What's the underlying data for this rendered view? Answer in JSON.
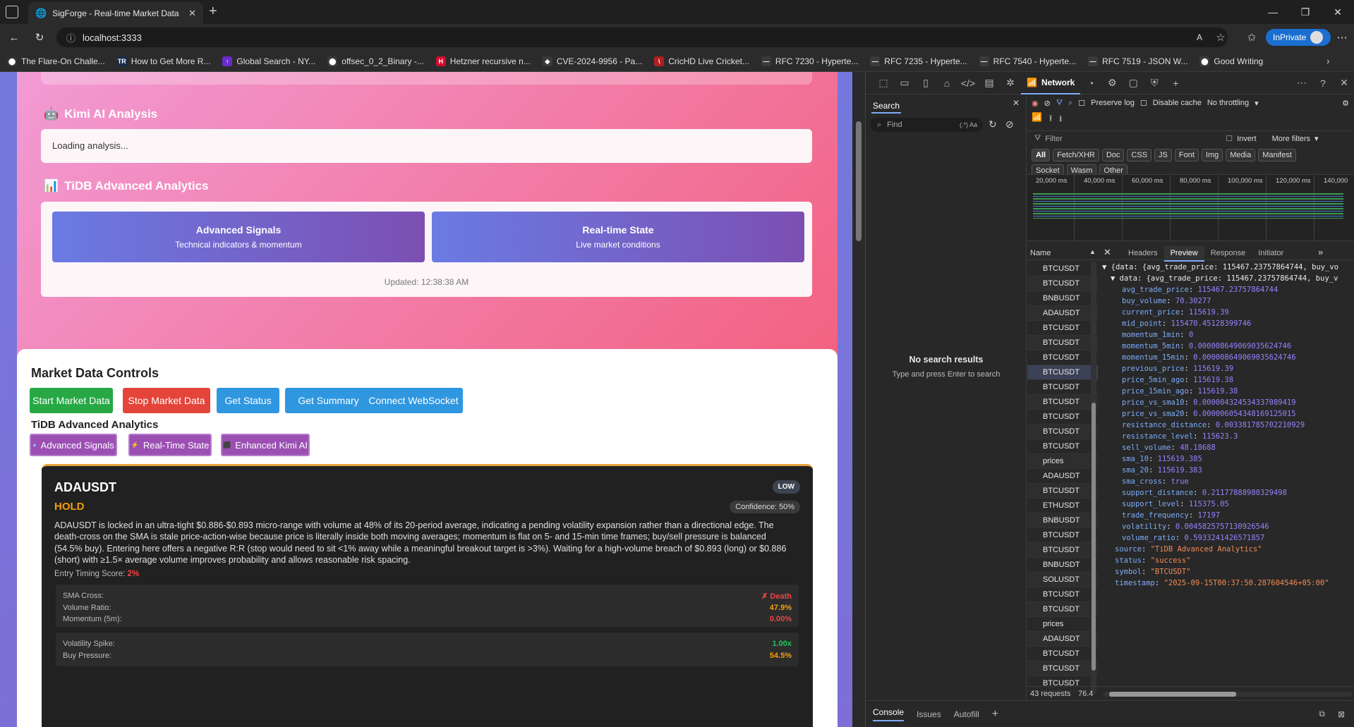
{
  "browser": {
    "tab_title": "SigForge - Real-time Market Data",
    "url": "localhost:3333",
    "inprivate_label": "InPrivate",
    "bookmarks": [
      {
        "label": "The Flare-On Challe...",
        "color": "#333",
        "glyph": "⬤"
      },
      {
        "label": "How to Get More R...",
        "color": "#1b2b4a",
        "glyph": "TR"
      },
      {
        "label": "Global Search - NY...",
        "color": "#6a2cc9",
        "glyph": "↑"
      },
      {
        "label": "offsec_0_2_Binary -...",
        "color": "#3a3a3a",
        "glyph": "⬤"
      },
      {
        "label": "Hetzner recursive n...",
        "color": "#d50c2d",
        "glyph": "H"
      },
      {
        "label": "CVE-2024-9956 - Pa...",
        "color": "#3a3a3a",
        "glyph": "◆"
      },
      {
        "label": "CricHD Live Cricket...",
        "color": "#b12020",
        "glyph": "\\"
      },
      {
        "label": "RFC 7230 - Hyperte...",
        "color": "#3a3a3a",
        "glyph": "—"
      },
      {
        "label": "RFC 7235 - Hyperte...",
        "color": "#3a3a3a",
        "glyph": "—"
      },
      {
        "label": "RFC 7540 - Hyperte...",
        "color": "#3a3a3a",
        "glyph": "—"
      },
      {
        "label": "RFC 7519 - JSON W...",
        "color": "#3a3a3a",
        "glyph": "—"
      },
      {
        "label": "Good Writing",
        "color": "#3a3a3a",
        "glyph": "⬤"
      }
    ]
  },
  "page": {
    "kimi": {
      "title": "Kimi AI Analysis",
      "loading": "Loading analysis..."
    },
    "tidb": {
      "title": "TiDB Advanced Analytics",
      "cards": [
        {
          "title": "Advanced Signals",
          "subtitle": "Technical indicators & momentum"
        },
        {
          "title": "Real-time State",
          "subtitle": "Live market conditions"
        }
      ],
      "updated": "Updated: 12:38:38 AM"
    },
    "controls": {
      "title": "Market Data Controls",
      "buttons": [
        {
          "label": "Start Market Data",
          "color": "#27a845"
        },
        {
          "label": "Stop Market Data",
          "color": "#e5443a"
        },
        {
          "label": "Get Status",
          "color": "#2f97e0"
        },
        {
          "label": "Get Summary",
          "color": "#2f97e0"
        },
        {
          "label": "Connect WebSocket",
          "color": "#2f97e0"
        }
      ],
      "tidb_label": "TiDB Advanced Analytics",
      "purple_buttons": [
        {
          "label": "Advanced Signals",
          "glyph": "●"
        },
        {
          "label": "Real-Time State",
          "glyph": "⚡"
        },
        {
          "label": "Enhanced Kimi AI",
          "glyph": "⬛"
        }
      ]
    },
    "signal_card": {
      "symbol": "ADAUSDT",
      "risk": "LOW",
      "action": "HOLD",
      "confidence": "Confidence: 50%",
      "description": "ADAUSDT is locked in an ultra-tight $0.886-$0.893 micro-range with volume at 48% of its 20-period average, indicating a pending volatility expansion rather than a directional edge. The death-cross on the SMA is stale price-action-wise because price is literally inside both moving averages; momentum is flat on 5- and 15-min time frames; buy/sell pressure is balanced (54.5% buy). Entering here offers a negative R:R (stop would need to sit <1% away while a meaningful breakout target is >3%). Waiting for a high-volume breach of $0.893 (long) or $0.886 (short) with ≥1.5× average volume improves probability and allows reasonable risk spacing.",
      "entry_label": "Entry Timing Score:",
      "entry_value": "2%",
      "metrics1": [
        {
          "label": "SMA Cross:",
          "value": "✗ Death",
          "color": "#ef4444"
        },
        {
          "label": "Volume Ratio:",
          "value": "47.9%",
          "color": "#f59e0b"
        },
        {
          "label": "Momentum (5m):",
          "value": "0.00%",
          "color": "#ef4444"
        }
      ],
      "metrics2": [
        {
          "label": "Volatility Spike:",
          "value": "1.00x",
          "color": "#22c55e"
        },
        {
          "label": "Buy Pressure:",
          "value": "54.5%",
          "color": "#f59e0b"
        }
      ]
    }
  },
  "devtools": {
    "network_tab": "Network",
    "search_tab": "Search",
    "find_placeholder": "Find",
    "regex_label": "(.*) Aa",
    "no_results": "No search results",
    "no_results_hint": "Type and press Enter to search",
    "preserve_log": "Preserve log",
    "disable_cache": "Disable cache",
    "throttling": "No throttling",
    "filter_placeholder": "Filter",
    "invert": "Invert",
    "more_filters": "More filters",
    "filter_chips": [
      "All",
      "Fetch/XHR",
      "Doc",
      "CSS",
      "JS",
      "Font",
      "Img",
      "Media",
      "Manifest",
      "Socket",
      "Wasm",
      "Other"
    ],
    "timeline_ticks": [
      "20,000 ms",
      "40,000 ms",
      "60,000 ms",
      "80,000 ms",
      "100,000 ms",
      "120,000 ms",
      "140,000"
    ],
    "name_header": "Name",
    "detail_tabs": [
      "Headers",
      "Preview",
      "Response",
      "Initiator"
    ],
    "requests": [
      "BTCUSDT",
      "BTCUSDT",
      "BNBUSDT",
      "ADAUSDT",
      "BTCUSDT",
      "BTCUSDT",
      "BTCUSDT",
      "BTCUSDT",
      "BTCUSDT",
      "BTCUSDT",
      "BTCUSDT",
      "BTCUSDT",
      "BTCUSDT",
      "prices",
      "ADAUSDT",
      "BTCUSDT",
      "ETHUSDT",
      "BNBUSDT",
      "BTCUSDT",
      "BTCUSDT",
      "BNBUSDT",
      "SOLUSDT",
      "BTCUSDT",
      "BTCUSDT",
      "prices",
      "ADAUSDT",
      "BTCUSDT",
      "BTCUSDT",
      "BTCUSDT"
    ],
    "requests_count": "43 requests",
    "transfer": "76.4",
    "preview": {
      "line1": "{data: {avg_trade_price: 115467.23757864744, buy_vo",
      "line2": "data: {avg_trade_price: 115467.23757864744, buy_v",
      "fields": [
        {
          "k": "avg_trade_price",
          "v": "115467.23757864744",
          "t": "n"
        },
        {
          "k": "buy_volume",
          "v": "70.30277",
          "t": "n"
        },
        {
          "k": "current_price",
          "v": "115619.39",
          "t": "n"
        },
        {
          "k": "mid_point",
          "v": "115470.45128399746",
          "t": "n"
        },
        {
          "k": "momentum_1min",
          "v": "0",
          "t": "n"
        },
        {
          "k": "momentum_5min",
          "v": "0.000008649069035624746",
          "t": "n"
        },
        {
          "k": "momentum_15min",
          "v": "0.000008649069035624746",
          "t": "n"
        },
        {
          "k": "previous_price",
          "v": "115619.39",
          "t": "n"
        },
        {
          "k": "price_5min_ago",
          "v": "115619.38",
          "t": "n"
        },
        {
          "k": "price_15min_ago",
          "v": "115619.38",
          "t": "n"
        },
        {
          "k": "price_vs_sma10",
          "v": "0.000004324534337089419",
          "t": "n"
        },
        {
          "k": "price_vs_sma20",
          "v": "0.000006054348169125015",
          "t": "n"
        },
        {
          "k": "resistance_distance",
          "v": "0.003381785702210929",
          "t": "n"
        },
        {
          "k": "resistance_level",
          "v": "115623.3",
          "t": "n"
        },
        {
          "k": "sell_volume",
          "v": "48.18688",
          "t": "n"
        },
        {
          "k": "sma_10",
          "v": "115619.385",
          "t": "n"
        },
        {
          "k": "sma_20",
          "v": "115619.383",
          "t": "n"
        },
        {
          "k": "sma_cross",
          "v": "true",
          "t": "n"
        },
        {
          "k": "support_distance",
          "v": "0.21177888980329498",
          "t": "n"
        },
        {
          "k": "support_level",
          "v": "115375.05",
          "t": "n"
        },
        {
          "k": "trade_frequency",
          "v": "17197",
          "t": "n"
        },
        {
          "k": "volatility",
          "v": "0.004582575713092654​6",
          "t": "n"
        },
        {
          "k": "volume_ratio",
          "v": "0.5933241426571857",
          "t": "n"
        }
      ],
      "tail": [
        {
          "k": "source",
          "v": "\"TiDB Advanced Analytics\"",
          "t": "s"
        },
        {
          "k": "status",
          "v": "\"success\"",
          "t": "s"
        },
        {
          "k": "symbol",
          "v": "\"BTCUSDT\"",
          "t": "s"
        },
        {
          "k": "timestamp",
          "v": "\"2025-09-15T00:37:50.287604546+05:00\"",
          "t": "s"
        }
      ]
    },
    "bottom_tabs": [
      "Console",
      "Issues",
      "Autofill"
    ]
  }
}
